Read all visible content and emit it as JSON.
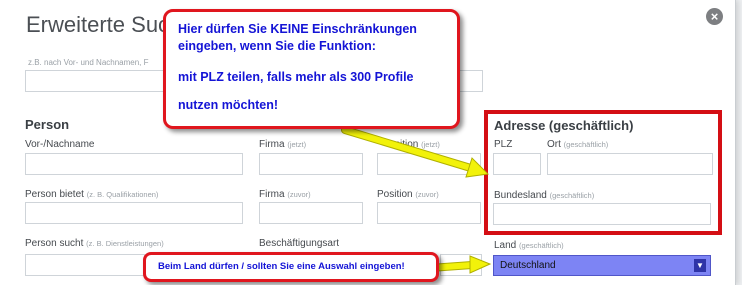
{
  "dialog": {
    "title": "Erweiterte Suche",
    "close_icon": "close-icon",
    "name_hint": "z.B. nach Vor- und Nachnamen, F"
  },
  "person": {
    "heading": "Person",
    "name_label": "Vor-/Nachname",
    "firma_label": "Firma",
    "firma_hint": "(jetzt)",
    "position_label_partial": "sition",
    "position_hint": "(jetzt)",
    "bietet_label": "Person bietet",
    "bietet_hint": "(z. B. Qualifikationen)",
    "firma_zuvor_label": "Firma",
    "firma_zuvor_hint": "(zuvor)",
    "position_zuvor_label": "Position",
    "position_zuvor_hint": "(zuvor)",
    "sucht_label": "Person sucht",
    "sucht_hint": "(z. B. Dienstleistungen)",
    "beschaeftigung_label": "Beschäftigungsart"
  },
  "address": {
    "heading": "Adresse (geschäftlich)",
    "plz_label": "PLZ",
    "ort_label": "Ort",
    "ort_hint": "(geschäftlich)",
    "bundesland_label": "Bundesland",
    "bundesland_hint": "(geschäftlich)",
    "land_label": "Land",
    "land_hint": "(geschäftlich)",
    "land_value": "Deutschland"
  },
  "annotations": {
    "callout1_line1": "Hier dürfen Sie  KEINE  Einschränkungen",
    "callout1_line2": "eingeben, wenn Sie die Funktion:",
    "callout1_line3": "mit PLZ teilen, falls mehr als 300 Profile",
    "callout1_line4": "nutzen möchten!",
    "callout2": "Beim Land dürfen / sollten Sie eine Auswahl eingeben!",
    "callout_border_color": "#e0161e",
    "callout_text_color": "#1414d6",
    "arrow_color": "#f2f20a"
  }
}
